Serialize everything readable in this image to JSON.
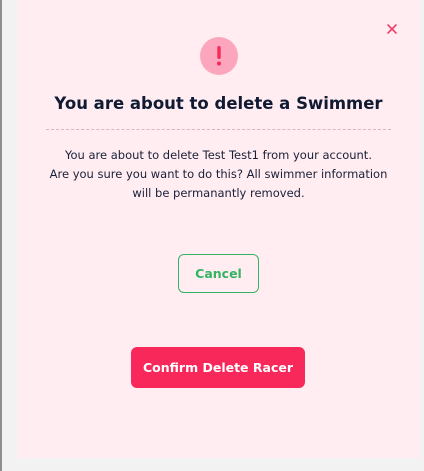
{
  "modal": {
    "title": "You are about to delete a Swimmer",
    "message_lines": [
      "You are about to delete Test Test1 from your account.",
      "Are you sure you want to do this? All swimmer information",
      "will be permanantly removed."
    ],
    "cancel_label": "Cancel",
    "confirm_label": "Confirm Delete Racer",
    "icons": {
      "close": "close-icon",
      "alert": "exclamation-icon"
    }
  },
  "colors": {
    "modal_background": "#ffedf1",
    "alert_circle": "#fca6bd",
    "alert_mark": "#f8285a",
    "close_icon": "#f1416c",
    "title": "#101a33",
    "cancel_accent": "#35b262",
    "confirm_background": "#f8285a"
  }
}
